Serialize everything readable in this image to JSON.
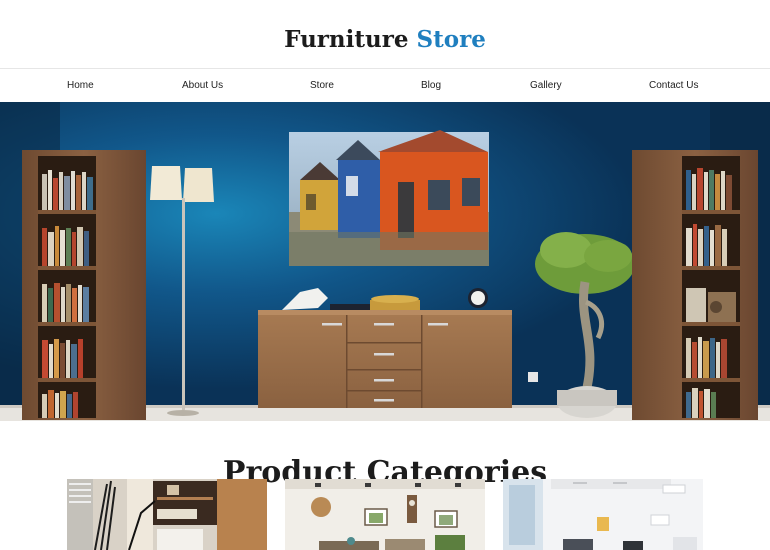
{
  "brand": {
    "name_main": "Furniture",
    "name_accent": "Store",
    "accent_color": "#1f7fbf"
  },
  "nav": {
    "items": [
      {
        "label": "Home"
      },
      {
        "label": "About Us"
      },
      {
        "label": "Store"
      },
      {
        "label": "Blog"
      },
      {
        "label": "Gallery"
      },
      {
        "label": "Contact Us"
      }
    ]
  },
  "hero": {
    "wall_color": "#0f4a78",
    "image": "living-room-blue-wall"
  },
  "categories": {
    "title": "Product Categories",
    "images": [
      "home-office",
      "living-room",
      "white-interior"
    ]
  }
}
